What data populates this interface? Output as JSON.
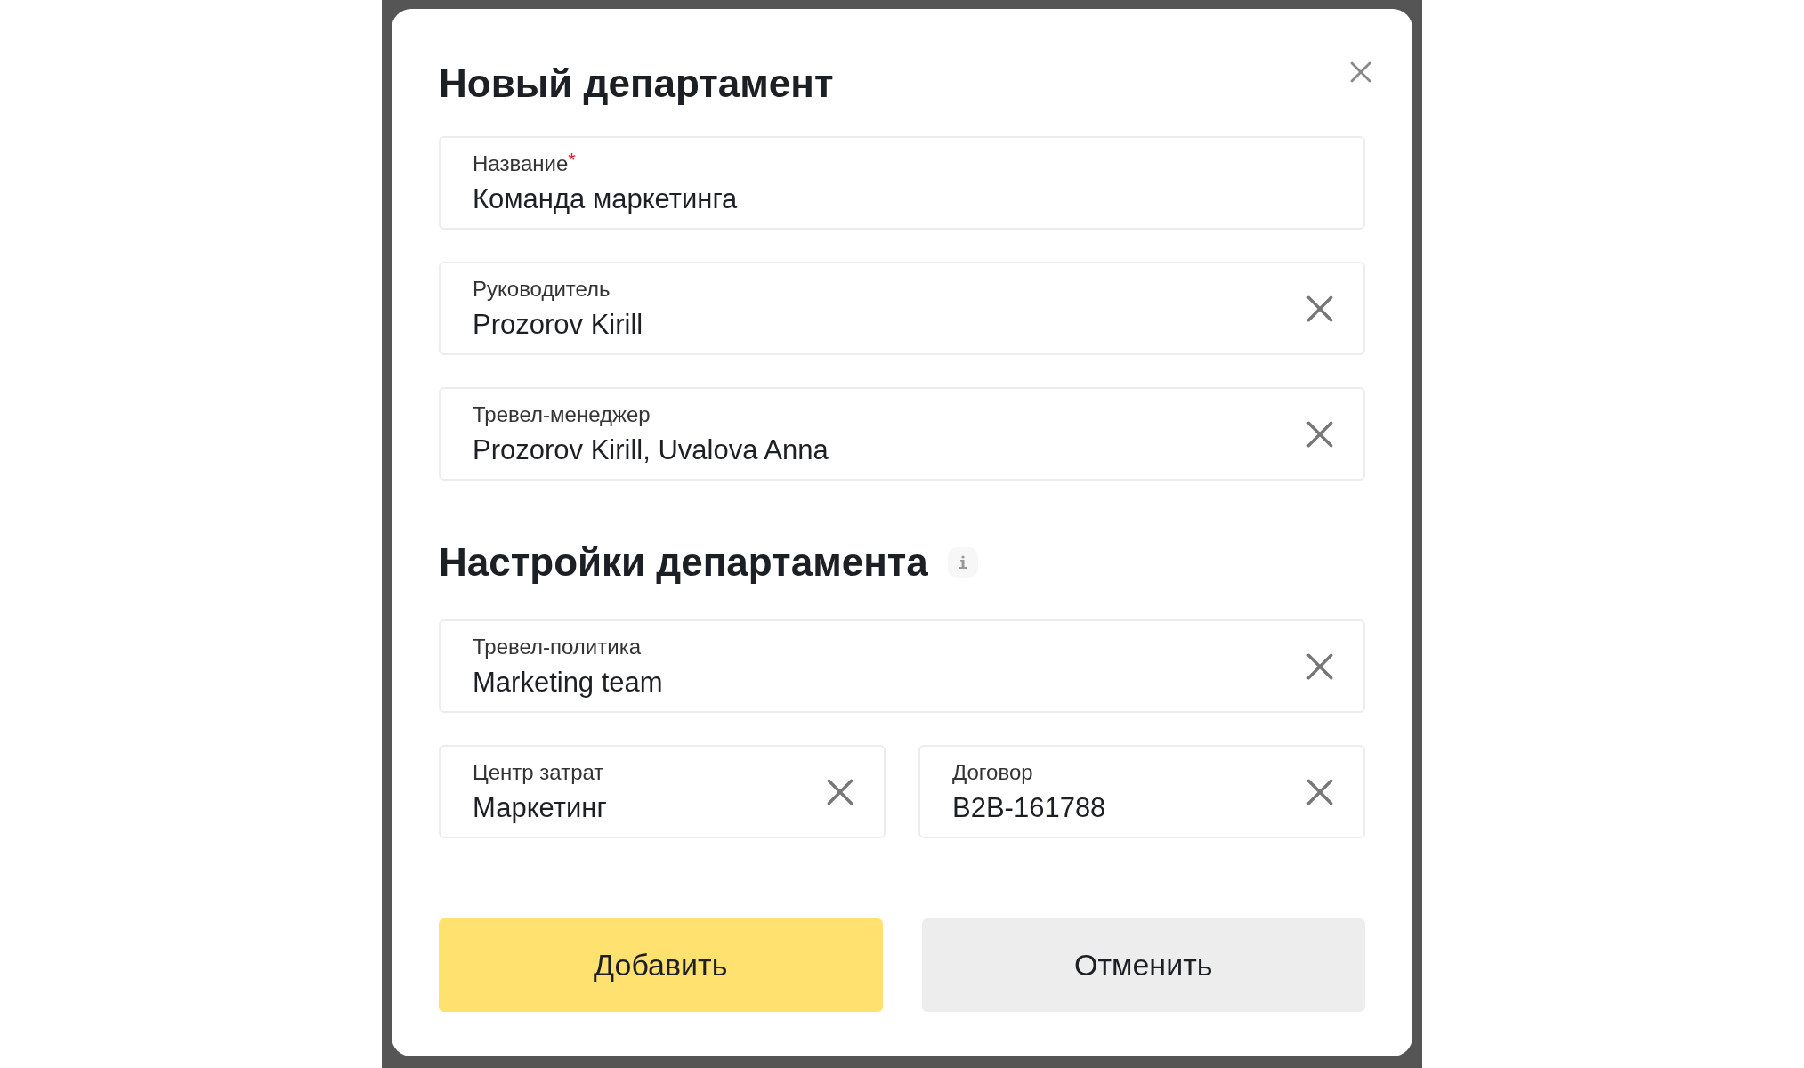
{
  "dialog": {
    "title": "Новый департамент",
    "fields": [
      {
        "label": "Название",
        "required_mark": "*",
        "value": "Команда маркетинга",
        "clearable": false
      },
      {
        "label": "Руководитель",
        "value": "Prozorov Kirill",
        "clearable": true
      },
      {
        "label": "Тревел-менеджер",
        "value": "Prozorov Kirill, Uvalova Anna",
        "clearable": true
      }
    ],
    "settings": {
      "title": "Настройки департамента",
      "fields": [
        {
          "label": "Тревел-политика",
          "value": "Marketing team",
          "clearable": true
        },
        {
          "label": "Центр затрат",
          "value": "Маркетинг",
          "clearable": true
        },
        {
          "label": "Договор",
          "value": "B2B-161788",
          "clearable": true
        }
      ]
    },
    "buttons": [
      {
        "label": "Добавить",
        "kind": "primary"
      },
      {
        "label": "Отменить",
        "kind": "secondary"
      }
    ]
  }
}
